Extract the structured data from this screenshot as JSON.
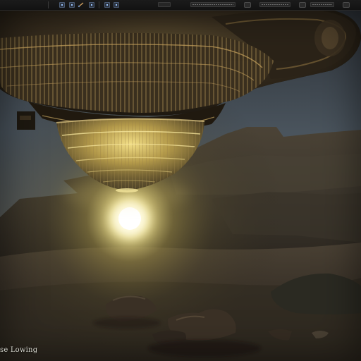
{
  "toolbar": {
    "buttons": [
      {
        "icon": "transform-icon"
      },
      {
        "icon": "translate-icon"
      },
      {
        "icon": "rotate-icon"
      },
      {
        "icon": "scale-icon"
      },
      {
        "icon": "camera-icon"
      },
      {
        "icon": "lock-icon"
      }
    ],
    "toggles": [
      {
        "icon": "snap-icon"
      },
      {
        "icon": "grid-icon"
      },
      {
        "icon": "view-options-icon"
      }
    ],
    "colors": {
      "bar": "#151515",
      "accent": "#9ec7ff"
    }
  },
  "viewport": {
    "status_text": "se Lowing",
    "scene_description_icon": "viewport-scene-icon"
  }
}
